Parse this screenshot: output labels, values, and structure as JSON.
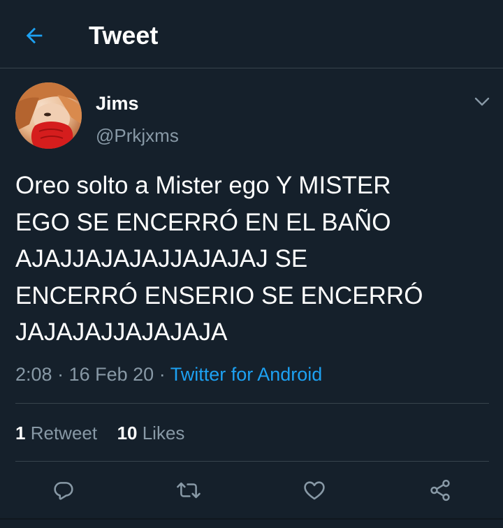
{
  "header": {
    "title": "Tweet",
    "back_icon": "arrow-left-icon"
  },
  "author": {
    "name": "Jims",
    "handle": "@Prkjxms"
  },
  "tweet": {
    "lines": [
      "Oreo solto a Mister ego Y MISTER",
      "EGO SE ENCERRÓ EN EL BAÑO",
      "AJAJJAJAJAJJAJAJAJ SE",
      "ENCERRÓ ENSERIO SE ENCERRÓ",
      "JAJAJAJJAJAJAJA"
    ],
    "time": "2:08",
    "date": "16 Feb 20",
    "separator": "·",
    "source": "Twitter for Android"
  },
  "stats": {
    "retweets_count": "1",
    "retweets_label": "Retweet",
    "likes_count": "10",
    "likes_label": "Likes"
  },
  "actions": [
    "reply-icon",
    "retweet-icon",
    "like-icon",
    "share-icon"
  ],
  "colors": {
    "background": "#15202b",
    "accent": "#1da1f2",
    "secondary_text": "#8899a6",
    "divider": "#38444d"
  }
}
